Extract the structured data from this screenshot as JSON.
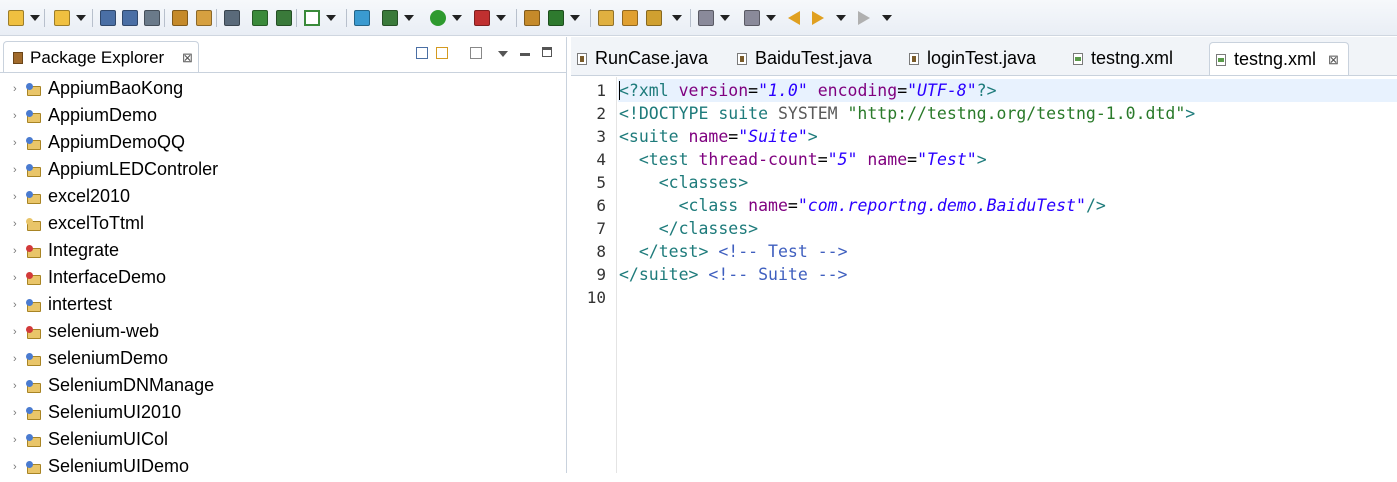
{
  "toolbar": {
    "icons": [
      "new-wizard",
      "dropdown",
      "new-project",
      "dropdown",
      "save",
      "save-all",
      "print",
      "open-type",
      "open-resource",
      "skip-breakpoints",
      "external-tools",
      "run-test",
      "checkmark",
      "dropdown",
      "new-class",
      "debug",
      "dropdown",
      "run",
      "dropdown",
      "run-external",
      "dropdown",
      "new-java-package",
      "git",
      "dropdown",
      "open-folder",
      "open-file",
      "search",
      "dropdown",
      "next-annotation",
      "dropdown",
      "prev-annotation",
      "dropdown",
      "back",
      "forward",
      "dropdown",
      "forward-nav",
      "dropdown"
    ]
  },
  "package_explorer": {
    "title": "Package Explorer",
    "close_glyph": "⊠",
    "projects": [
      {
        "label": "AppiumBaoKong",
        "badge": "#4a7bd0"
      },
      {
        "label": "AppiumDemo",
        "badge": "#4a7bd0"
      },
      {
        "label": "AppiumDemoQQ",
        "badge": "#4a7bd0"
      },
      {
        "label": "AppiumLEDControler",
        "badge": "#4a7bd0"
      },
      {
        "label": "excel2010",
        "badge": "#4a7bd0"
      },
      {
        "label": "excelToTtml",
        "badge": "#e9c569"
      },
      {
        "label": "Integrate",
        "badge": "#d23a3a"
      },
      {
        "label": "InterfaceDemo",
        "badge": "#d23a3a"
      },
      {
        "label": "intertest",
        "badge": "#4a7bd0"
      },
      {
        "label": "selenium-web",
        "badge": "#d23a3a"
      },
      {
        "label": "seleniumDemo",
        "badge": "#4a7bd0"
      },
      {
        "label": "SeleniumDNManage",
        "badge": "#4a7bd0"
      },
      {
        "label": "SeleniumUI2010",
        "badge": "#4a7bd0"
      },
      {
        "label": "SeleniumUICol",
        "badge": "#4a7bd0"
      },
      {
        "label": "SeleniumUIDemo",
        "badge": "#4a7bd0"
      }
    ]
  },
  "editor": {
    "tabs": [
      {
        "label": "RunCase.java",
        "kind": "java"
      },
      {
        "label": "BaiduTest.java",
        "kind": "java"
      },
      {
        "label": "loginTest.java",
        "kind": "java"
      },
      {
        "label": "testng.xml",
        "kind": "xml"
      },
      {
        "label": "testng.xml",
        "kind": "xml",
        "active": true
      }
    ],
    "close_glyph": "⊠",
    "line_numbers": [
      "1",
      "2",
      "3",
      "4",
      "5",
      "6",
      "7",
      "8",
      "9",
      "10"
    ],
    "lines": [
      [
        [
          "t-tag",
          "<?xml "
        ],
        [
          "t-attr",
          "version"
        ],
        [
          "t-plain",
          "="
        ],
        [
          "t-str",
          "\"1.0\""
        ],
        [
          "t-plain",
          " "
        ],
        [
          "t-attr",
          "encoding"
        ],
        [
          "t-plain",
          "="
        ],
        [
          "t-str",
          "\"UTF-8\""
        ],
        [
          "t-tag",
          "?>"
        ]
      ],
      [
        [
          "t-dt",
          "<!DOCTYPE suite "
        ],
        [
          "t-dtv",
          "SYSTEM "
        ],
        [
          "t-dts",
          "\"http://testng.org/testng-1.0.dtd\""
        ],
        [
          "t-dt",
          ">"
        ]
      ],
      [
        [
          "t-tag",
          "<suite "
        ],
        [
          "t-attr",
          "name"
        ],
        [
          "t-plain",
          "="
        ],
        [
          "t-str",
          "\"Suite\""
        ],
        [
          "t-tag",
          ">"
        ]
      ],
      [
        [
          "t-plain",
          "  "
        ],
        [
          "t-tag",
          "<test "
        ],
        [
          "t-attr",
          "thread-count"
        ],
        [
          "t-plain",
          "="
        ],
        [
          "t-str",
          "\"5\""
        ],
        [
          "t-plain",
          " "
        ],
        [
          "t-attr",
          "name"
        ],
        [
          "t-plain",
          "="
        ],
        [
          "t-str",
          "\"Test\""
        ],
        [
          "t-tag",
          ">"
        ]
      ],
      [
        [
          "t-plain",
          "    "
        ],
        [
          "t-tag",
          "<classes>"
        ]
      ],
      [
        [
          "t-plain",
          "      "
        ],
        [
          "t-tag",
          "<class "
        ],
        [
          "t-attr",
          "name"
        ],
        [
          "t-plain",
          "="
        ],
        [
          "t-str",
          "\"com.reportng.demo.BaiduTest\""
        ],
        [
          "t-tag",
          "/>"
        ]
      ],
      [
        [
          "t-plain",
          "    "
        ],
        [
          "t-tag",
          "</classes>"
        ]
      ],
      [
        [
          "t-plain",
          "  "
        ],
        [
          "t-tag",
          "</test>"
        ],
        [
          "t-plain",
          " "
        ],
        [
          "t-com",
          "<!-- Test -->"
        ]
      ],
      [
        [
          "t-tag",
          "</suite>"
        ],
        [
          "t-plain",
          " "
        ],
        [
          "t-com",
          "<!-- Suite -->"
        ]
      ],
      []
    ]
  }
}
